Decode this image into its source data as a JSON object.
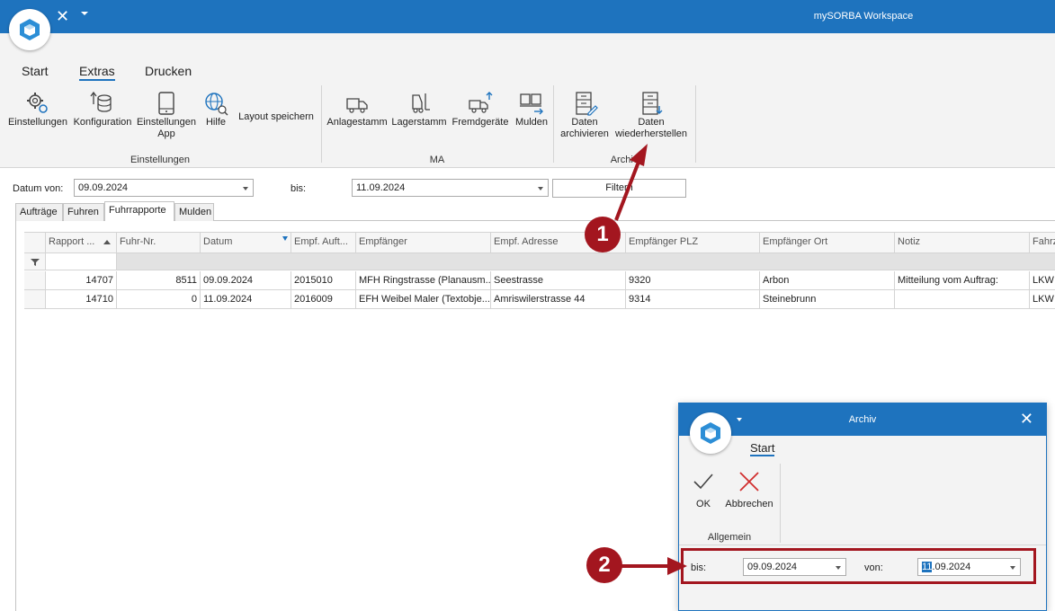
{
  "app": {
    "title": "mySORBA Workspace"
  },
  "ribbon": {
    "tabs": [
      "Start",
      "Extras",
      "Drucken"
    ],
    "groups": {
      "einstellungen": {
        "label": "Einstellungen",
        "buttons": [
          "Einstellungen",
          "Konfiguration",
          "Einstellungen App",
          "Hilfe",
          "Layout speichern"
        ]
      },
      "ma": {
        "label": "MA",
        "buttons": [
          "Anlagestamm",
          "Lagerstamm",
          "Fremdgeräte",
          "Mulden"
        ]
      },
      "archiv": {
        "label": "Archiv",
        "buttons": [
          "Daten archivieren",
          "Daten wiederherstellen"
        ]
      }
    }
  },
  "filter": {
    "datum_von_label": "Datum von:",
    "datum_von": "09.09.2024",
    "bis_label": "bis:",
    "bis": "11.09.2024",
    "filter_button": "Filtern"
  },
  "grid_tabs": [
    "Aufträge",
    "Fuhren",
    "Fuhrrapporte",
    "Mulden"
  ],
  "table": {
    "columns": [
      "Rapport ...",
      "Fuhr-Nr.",
      "Datum",
      "Empf. Auft...",
      "Empfänger",
      "Empf. Adresse",
      "Empfänger PLZ",
      "Empfänger Ort",
      "Notiz",
      "Fahrz"
    ],
    "rows": [
      [
        "14707",
        "8511",
        "09.09.2024",
        "2015010",
        "MFH Ringstrasse (Planausm...",
        "Seestrasse",
        "9320",
        "Arbon",
        "Mitteilung vom Auftrag:",
        "LKW"
      ],
      [
        "14710",
        "0",
        "11.09.2024",
        "2016009",
        "EFH Weibel Maler (Textobje...",
        "Amriswilerstrasse 44",
        "9314",
        "Steinebrunn",
        "",
        "LKW"
      ]
    ]
  },
  "dialog": {
    "title": "Archiv",
    "tab": "Start",
    "ok": "OK",
    "cancel": "Abbrechen",
    "group": "Allgemein",
    "bis_label": "bis:",
    "bis_value": "09.09.2024",
    "von_label": "von:",
    "von_value_selected": "11",
    "von_value_rest": ".09.2024"
  },
  "annotations": {
    "marker_1": "1",
    "marker_2": "2"
  },
  "colors": {
    "accent": "#1e73be",
    "annotation": "#a3161f"
  }
}
